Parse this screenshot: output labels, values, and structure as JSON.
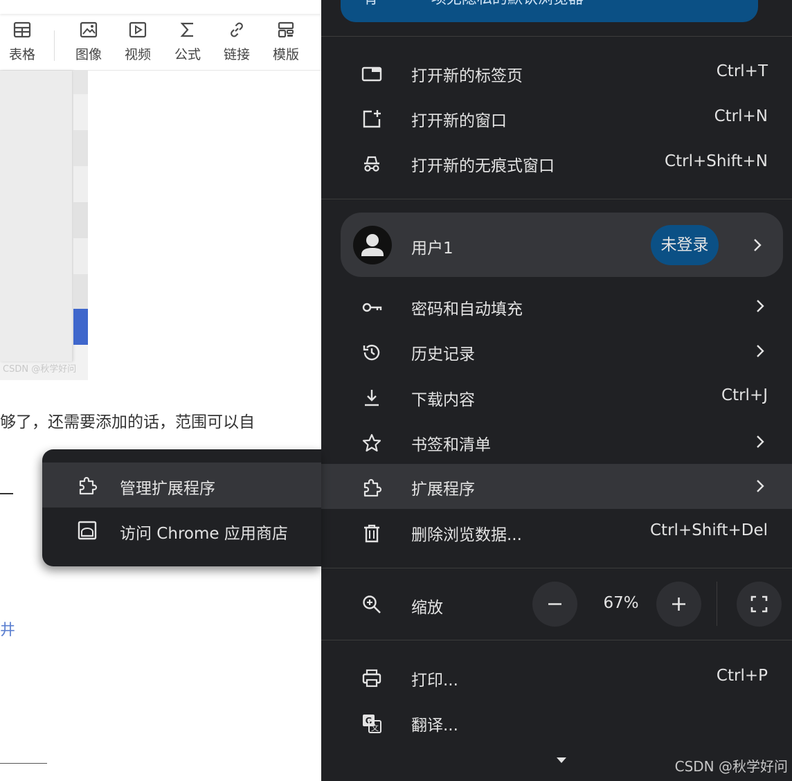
{
  "editor": {
    "toolbar": [
      {
        "name": "table",
        "label": "表格"
      },
      {
        "name": "image",
        "label": "图像"
      },
      {
        "name": "video",
        "label": "视频"
      },
      {
        "name": "formula",
        "label": "公式"
      },
      {
        "name": "link",
        "label": "链接"
      },
      {
        "name": "template",
        "label": "模版"
      }
    ],
    "screenshot_watermark": "CSDN @秋学好问",
    "body_text": "够了，还需要添加的话，范围可以自",
    "link_fragment": "井"
  },
  "menu": {
    "banner_text": "有 · · · · · 项无隐私的默认浏览器",
    "items_top": [
      {
        "name": "new-tab",
        "label": "打开新的标签页",
        "shortcut": "Ctrl+T"
      },
      {
        "name": "new-window",
        "label": "打开新的窗口",
        "shortcut": "Ctrl+N"
      },
      {
        "name": "new-incognito",
        "label": "打开新的无痕式窗口",
        "shortcut": "Ctrl+Shift+N"
      }
    ],
    "profile": {
      "name": "用户1",
      "status": "未登录"
    },
    "items_mid": [
      {
        "name": "passwords",
        "label": "密码和自动填充",
        "shortcut": ""
      },
      {
        "name": "history",
        "label": "历史记录",
        "shortcut": ""
      },
      {
        "name": "downloads",
        "label": "下载内容",
        "shortcut": "Ctrl+J"
      },
      {
        "name": "bookmarks",
        "label": "书签和清单",
        "shortcut": ""
      },
      {
        "name": "extensions",
        "label": "扩展程序",
        "shortcut": ""
      },
      {
        "name": "clear-data",
        "label": "删除浏览数据...",
        "shortcut": "Ctrl+Shift+Del"
      }
    ],
    "zoom": {
      "label": "缩放",
      "value": "67%"
    },
    "items_bottom": [
      {
        "name": "print",
        "label": "打印...",
        "shortcut": "Ctrl+P"
      },
      {
        "name": "translate",
        "label": "翻译...",
        "shortcut": ""
      }
    ],
    "watermark": "CSDN @秋学好问"
  },
  "submenu": {
    "items": [
      {
        "name": "manage-extensions",
        "label": "管理扩展程序"
      },
      {
        "name": "visit-store",
        "label": "访问 Chrome 应用商店"
      }
    ]
  },
  "colors": {
    "menu_bg": "#202124",
    "highlight": "#35363a",
    "accent": "#0b5085",
    "text": "#e3e3e3"
  }
}
